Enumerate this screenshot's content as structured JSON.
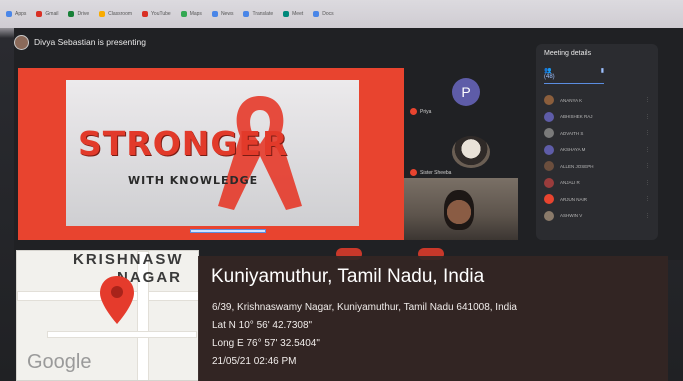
{
  "browser": {
    "bookmarks": [
      {
        "label": "Apps",
        "color": "#4a86e8"
      },
      {
        "label": "Gmail",
        "color": "#d93025"
      },
      {
        "label": "Drive",
        "color": "#188038"
      },
      {
        "label": "Classroom",
        "color": "#f9ab00"
      },
      {
        "label": "YouTube",
        "color": "#d93025"
      },
      {
        "label": "Maps",
        "color": "#34a853"
      },
      {
        "label": "News",
        "color": "#4a86e8"
      },
      {
        "label": "Translate",
        "color": "#4a86e8"
      },
      {
        "label": "Meet",
        "color": "#00897b"
      },
      {
        "label": "Docs",
        "color": "#4a86e8"
      }
    ]
  },
  "meet": {
    "presenter_text": "Divya Sebastian is presenting",
    "slide": {
      "title": "STRONGER",
      "subtitle": "WITH KNOWLEDGE"
    },
    "tiles": [
      {
        "avatar_letter": "P",
        "label": "Priya"
      },
      {
        "label": "Sister Sheeba"
      }
    ],
    "details_panel": {
      "title": "Meeting details",
      "people_count": "(48)",
      "people": [
        {
          "name": "ANANYA K",
          "color": "#8b5e3c"
        },
        {
          "name": "ABHISHEK RAJ",
          "color": "#5e5ca8"
        },
        {
          "name": "ADVAITH S",
          "color": "#7a7a7a"
        },
        {
          "name": "AKSHAYA M",
          "color": "#5e5ca8"
        },
        {
          "name": "ALLEN JOSEPH",
          "color": "#6b4e3d"
        },
        {
          "name": "ANJALI R",
          "color": "#9a3c3c"
        },
        {
          "name": "ARJUN NAIR",
          "color": "#e8442f"
        },
        {
          "name": "ASHWIN V",
          "color": "#8a7a6a"
        }
      ]
    }
  },
  "geotag": {
    "map_text_1": "KRISHNASW",
    "map_text_2": "NAGAR",
    "map_brand": "Google",
    "location_title": "Kuniyamuthur, Tamil Nadu, India",
    "address": "6/39, Krishnaswamy Nagar, Kuniyamuthur, Tamil Nadu 641008, India",
    "latitude": "Lat N 10° 56' 42.7308\"",
    "longitude": "Long E 76° 57' 32.5404\"",
    "datetime": "21/05/21 02:46 PM"
  }
}
